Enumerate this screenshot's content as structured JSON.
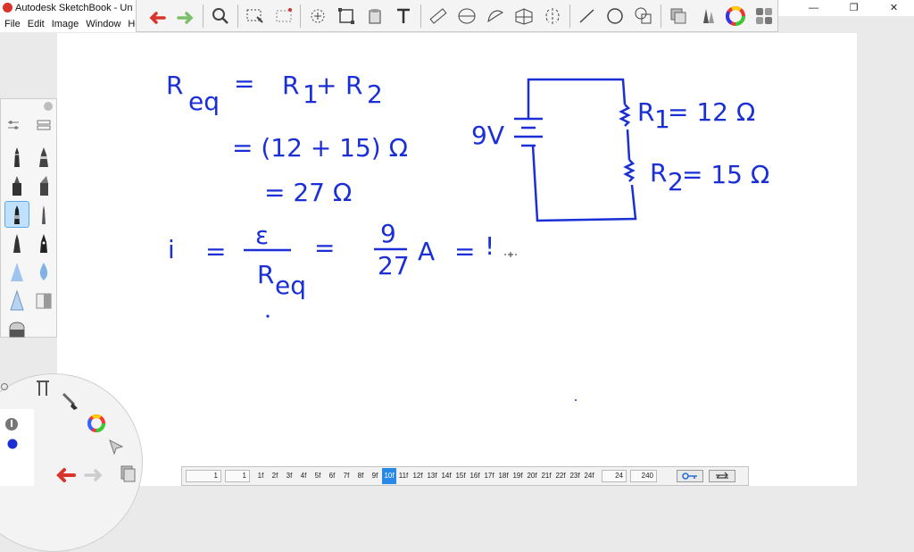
{
  "window": {
    "title": "Autodesk SketchBook - Untitled",
    "min": "—",
    "restore": "❐",
    "close": "✕"
  },
  "menu": [
    {
      "label": "File"
    },
    {
      "label": "Edit"
    },
    {
      "label": "Image"
    },
    {
      "label": "Window"
    },
    {
      "label": "Help"
    }
  ],
  "toolbar": [
    {
      "name": "undo-icon"
    },
    {
      "name": "redo-icon"
    },
    {
      "name": "zoom-icon"
    },
    {
      "name": "select-rect-icon"
    },
    {
      "name": "select-magic-icon"
    },
    {
      "name": "move-icon"
    },
    {
      "name": "crop-icon"
    },
    {
      "name": "fill-icon"
    },
    {
      "name": "text-icon"
    },
    {
      "name": "ruler-icon"
    },
    {
      "name": "ellipse-guide-icon"
    },
    {
      "name": "french-curve-icon"
    },
    {
      "name": "perspective-icon"
    },
    {
      "name": "symmetry-icon"
    },
    {
      "name": "line-icon"
    },
    {
      "name": "circle-icon"
    },
    {
      "name": "shape-icon"
    },
    {
      "name": "layers-icon"
    },
    {
      "name": "brush-library-icon"
    },
    {
      "name": "color-wheel-icon"
    },
    {
      "name": "copic-icon"
    }
  ],
  "canvas_text": {
    "l1_lhs": "R",
    "l1_sub": "eq",
    "l1_eq": "=",
    "l1_r1": "R",
    "l1_s1": "1",
    "l1_plus": "+",
    "l1_r2": "R",
    "l1_s2": "2",
    "l2": "= (12 + 15) Ω",
    "l3": "= 27 Ω",
    "l4_i": "i",
    "l4_eq1": "=",
    "l4_num": "ε",
    "l4_den": "R",
    "l4_densub": "eq",
    "l4_eq2": "=",
    "l4_fnum": "9",
    "l4_fden": "27",
    "l4_unit": "A",
    "l4_eq3": "=",
    "l4_tail": "!",
    "batt": "9V",
    "r1": "R",
    "r1_sub": "1",
    "r1_val": "= 12 Ω",
    "r2": "R",
    "r2_sub": "2",
    "r2_val": "= 15 Ω"
  },
  "timeline": {
    "start": "1",
    "current": "1",
    "frames": [
      "1f",
      "2f",
      "3f",
      "4f",
      "5f",
      "6f",
      "7f",
      "8f",
      "9f",
      "10f",
      "11f",
      "12f",
      "13f",
      "14f",
      "15f",
      "16f",
      "17f",
      "18f",
      "19f",
      "20f",
      "21f",
      "22f",
      "23f",
      "24f"
    ],
    "selected_frame": "10f",
    "fps": "24",
    "end": "240"
  },
  "colors": {
    "ink": "#1a2fd6",
    "accent": "#2a88e6",
    "undo": "#d8342b",
    "redo": "#7bbf6a"
  }
}
